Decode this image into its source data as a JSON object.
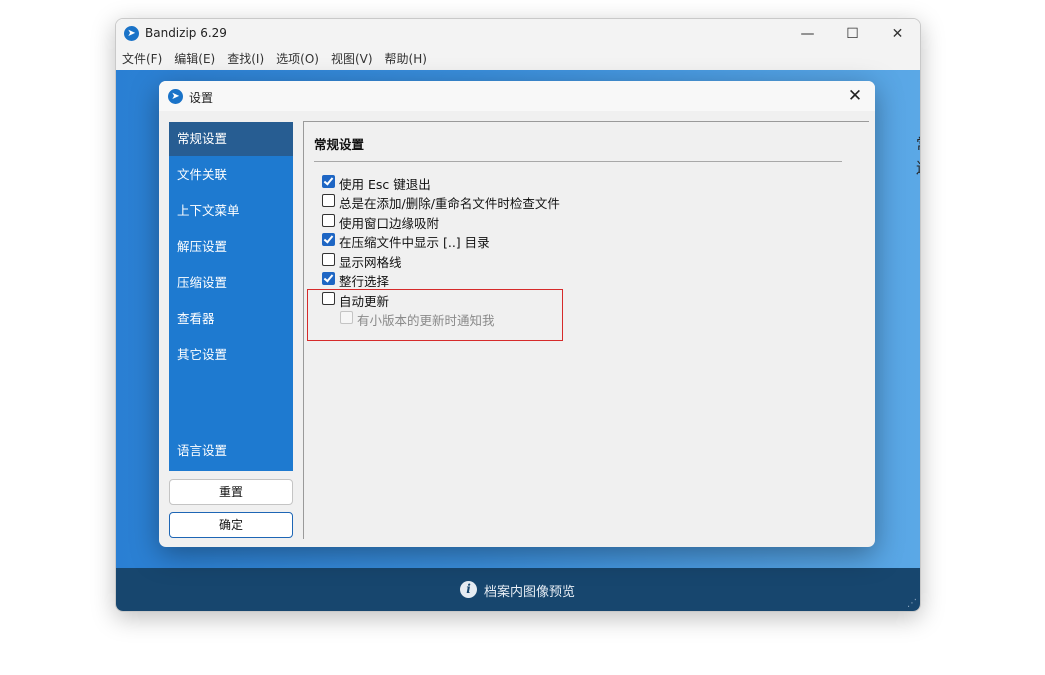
{
  "window": {
    "title": "Bandizip 6.29",
    "controls": {
      "minimize": "—",
      "maximize": "☐",
      "close": "✕"
    }
  },
  "menubar": [
    "文件(F)",
    "编辑(E)",
    "查找(I)",
    "选项(O)",
    "视图(V)",
    "帮助(H)"
  ],
  "background_text": [
    "常快",
    "送广"
  ],
  "statusbar": {
    "text": "档案内图像预览"
  },
  "dialog": {
    "title": "设置",
    "close": "✕",
    "sidebar": {
      "items": [
        "常规设置",
        "文件关联",
        "上下文菜单",
        "解压设置",
        "压缩设置",
        "查看器",
        "其它设置"
      ],
      "language": "语言设置",
      "active_index": 0
    },
    "buttons": {
      "reset": "重置",
      "ok": "确定"
    },
    "panel": {
      "title": "常规设置",
      "options": [
        {
          "label": "使用 Esc 键退出",
          "checked": true
        },
        {
          "label": "总是在添加/删除/重命名文件时检查文件",
          "checked": false
        },
        {
          "label": "使用窗口边缘吸附",
          "checked": false
        },
        {
          "label": "在压缩文件中显示 [..] 目录",
          "checked": true
        },
        {
          "label": "显示网格线",
          "checked": false
        },
        {
          "label": "整行选择",
          "checked": true
        },
        {
          "label": "自动更新",
          "checked": false
        },
        {
          "label": "有小版本的更新时通知我",
          "checked": false,
          "disabled": true
        }
      ]
    }
  },
  "colors": {
    "accent": "#1e7ad0",
    "sidebar_active": "#275d92",
    "checkbox_checked": "#1e66c4",
    "highlight": "#d62a2a",
    "statusbar": "#17466e"
  }
}
